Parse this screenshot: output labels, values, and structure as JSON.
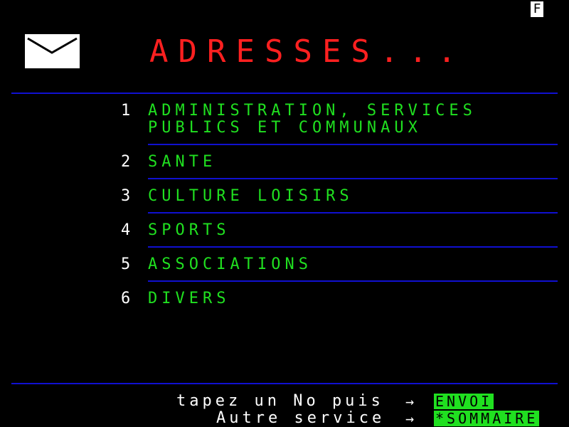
{
  "status": {
    "indicator": "F"
  },
  "header": {
    "title": "ADRESSES..."
  },
  "menu": [
    {
      "number": "1",
      "line1": "ADMINISTRATION, SERVICES",
      "line2": "PUBLICS ET COMMUNAUX"
    },
    {
      "number": "2",
      "line1": "SANTE"
    },
    {
      "number": "3",
      "line1": "CULTURE LOISIRS"
    },
    {
      "number": "4",
      "line1": "SPORTS"
    },
    {
      "number": "5",
      "line1": "ASSOCIATIONS"
    },
    {
      "number": "6",
      "line1": "DIVERS"
    }
  ],
  "footer": {
    "prompt": "tapez un No puis",
    "arrow": "→",
    "envoi_key": "ENVOI",
    "other_service": "Autre service",
    "sommaire_key": "*SOMMAIRE"
  },
  "colors": {
    "background": "#000000",
    "title": "#ff2020",
    "menu_text": "#20e020",
    "rule": "#1010d0",
    "key_bg": "#20e020"
  }
}
